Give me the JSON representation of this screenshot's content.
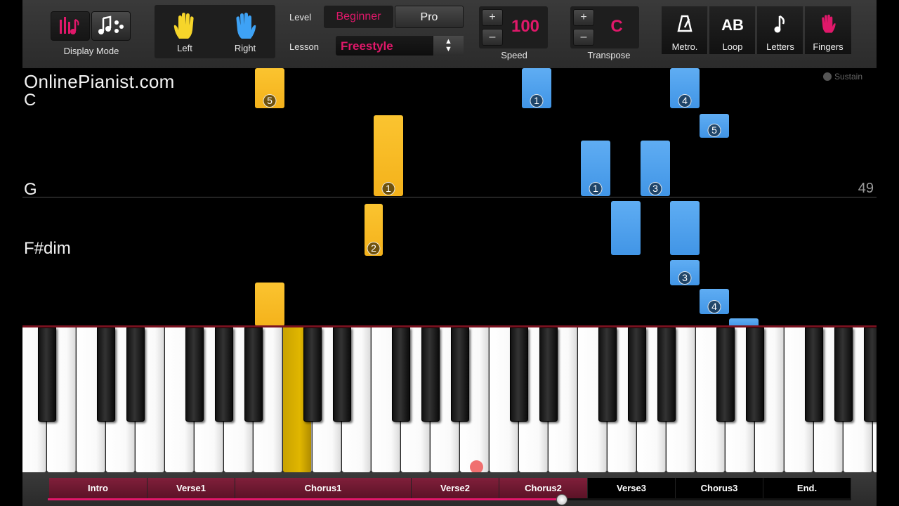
{
  "toolbar": {
    "display_mode_label": "Display Mode",
    "hands": {
      "left_label": "Left",
      "right_label": "Right"
    },
    "level": {
      "label": "Level",
      "beginner_label": "Beginner",
      "pro_label": "Pro",
      "selected": "Beginner"
    },
    "lesson": {
      "label": "Lesson",
      "value": "Freestyle"
    },
    "speed": {
      "label": "Speed",
      "value": "100",
      "plus": "+",
      "minus": "–"
    },
    "transpose": {
      "label": "Transpose",
      "value": "C",
      "plus": "+",
      "minus": "–"
    },
    "tools": {
      "metronome": "Metro.",
      "loop": "Loop",
      "loop_glyph": "AB",
      "letters": "Letters",
      "fingers": "Fingers"
    },
    "colors": {
      "accent": "#e0186a",
      "left_hand": "#f4b21b",
      "right_hand": "#4195e6"
    }
  },
  "waterfall": {
    "brand": "OnlinePianist.com",
    "sustain_label": "Sustain",
    "measure_number": "49",
    "chords": [
      "C",
      "G",
      "F#dim"
    ],
    "fingerings": {
      "left": [
        "5",
        "1",
        "2"
      ],
      "right": [
        "1",
        "4",
        "5",
        "1",
        "3",
        "3",
        "4"
      ]
    }
  },
  "sections": {
    "items": [
      {
        "label": "Intro",
        "played": true
      },
      {
        "label": "Verse1",
        "played": true
      },
      {
        "label": "Chorus1",
        "played": true
      },
      {
        "label": "Verse2",
        "played": true
      },
      {
        "label": "Chorus2",
        "played": true
      },
      {
        "label": "Verse3",
        "played": false
      },
      {
        "label": "Chorus3",
        "played": false
      },
      {
        "label": "End.",
        "played": false
      }
    ],
    "progress": 0.64
  }
}
